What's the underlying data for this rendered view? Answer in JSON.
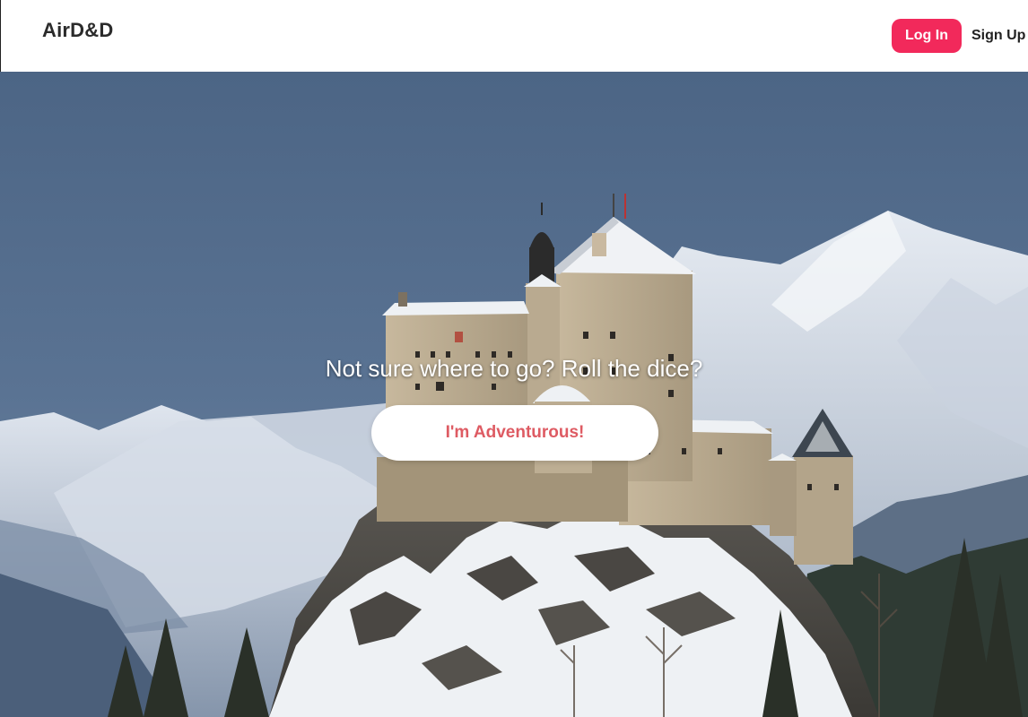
{
  "header": {
    "brand": "AirD&D",
    "login_label": "Log In",
    "signup_label": "Sign Up"
  },
  "hero": {
    "tagline": "Not sure where to go? Roll the dice?",
    "cta_label": "I'm Adventurous!",
    "background": "snowy-mountain-castle-photo"
  },
  "colors": {
    "accent": "#f2295b",
    "cta_text": "#de5b63"
  }
}
